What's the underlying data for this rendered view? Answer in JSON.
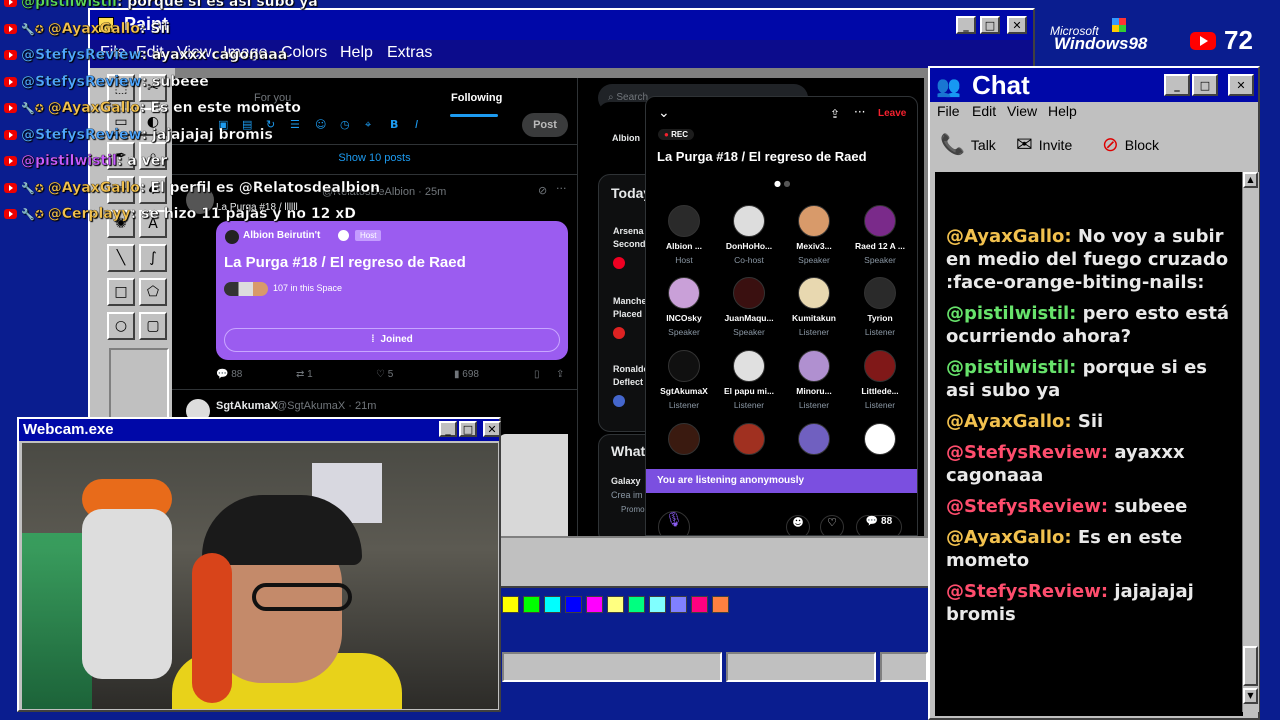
{
  "paint": {
    "title": "Paint",
    "menus": [
      "File",
      "Edit",
      "View",
      "Image",
      "Colors",
      "Help",
      "Extras"
    ],
    "palette": [
      "#ffff00",
      "#00ff00",
      "#00ffff",
      "#0000ff",
      "#ff00ff",
      "#ffff80",
      "#00ff80",
      "#80ffff",
      "#8080ff",
      "#ff0080",
      "#ff8040"
    ]
  },
  "twitter": {
    "tabs": [
      "For you",
      "Following"
    ],
    "post_label": "Post",
    "show_posts": "Show 10 posts",
    "search_placeholder": "Search",
    "post1": {
      "handle": "@RelatosDeAlbion · 25m",
      "body": "La Purga #18 / llllll"
    },
    "card": {
      "host_name": "Albion Beirutin't",
      "host_badge": "Host",
      "title": "La Purga #18 / El regreso de Raed",
      "listeners": "107 in this Space",
      "join_label": "Joined"
    },
    "actions": {
      "replies": "88",
      "retweets": "1",
      "likes": "5",
      "views": "698"
    },
    "post2": {
      "name": "SgtAkumaX",
      "handle": "@SgtAkumaX · 21m"
    },
    "sidebar": {
      "today": "Today",
      "albion": "Albion",
      "trends": [
        {
          "line1": "Arsena",
          "line2": "Second"
        },
        {
          "line1": "Manche",
          "line2": "Placed"
        },
        {
          "line1": "Ronaldo",
          "line2": "Deflect"
        }
      ],
      "whats": "What",
      "galaxy": "Galaxy",
      "galaxy_sub": "Crea im",
      "promo": "Promo"
    }
  },
  "space": {
    "rec": "REC",
    "leave": "Leave",
    "title": "La Purga #18 / El regreso de Raed",
    "people": [
      {
        "name": "Albion ...",
        "role": "Host",
        "color": "#2a2a2a"
      },
      {
        "name": "DonHoHo...",
        "role": "Co-host",
        "color": "#dddddd"
      },
      {
        "name": "Mexiv3...",
        "role": "Speaker",
        "color": "#d89a6a"
      },
      {
        "name": "Raed 12 A ...",
        "role": "Speaker",
        "color": "#7a2a8a"
      },
      {
        "name": "INCOsky",
        "role": "Speaker",
        "color": "#c9a0d8"
      },
      {
        "name": "JuanMaqu...",
        "role": "Speaker",
        "color": "#3a1010"
      },
      {
        "name": "Kumitakun",
        "role": "Listener",
        "color": "#e8d8b0"
      },
      {
        "name": "Tyrion",
        "role": "Listener",
        "color": "#2a2a2a"
      },
      {
        "name": "SgtAkumaX",
        "role": "Listener",
        "color": "#101010"
      },
      {
        "name": "El papu mi...",
        "role": "Listener",
        "color": "#e0e0e0"
      },
      {
        "name": "Minoru...",
        "role": "Listener",
        "color": "#b090d0"
      },
      {
        "name": "Littlede...",
        "role": "Listener",
        "color": "#801818"
      },
      {
        "name": "",
        "role": "",
        "color": "#3a1a10"
      },
      {
        "name": "",
        "role": "",
        "color": "#a03020"
      },
      {
        "name": "",
        "role": "",
        "color": "#7060c0"
      },
      {
        "name": "",
        "role": "",
        "color": "#ffffff"
      }
    ],
    "listening": "You are listening anonymously",
    "comments": "88"
  },
  "branding": {
    "microsoft": "Microsoft",
    "windows": "Windows98",
    "viewers": "72"
  },
  "chat": {
    "title": "Chat",
    "menus": [
      "File",
      "Edit",
      "View",
      "Help"
    ],
    "toolbar": {
      "talk": "Talk",
      "invite": "Invite",
      "block": "Block"
    },
    "messages": [
      {
        "user": "@AyaxGallo:",
        "text": " No voy a subir en medio del fuego cruzado :face-orange-biting-nails:",
        "color": "#f2c14e"
      },
      {
        "user": "@pistilwistil:",
        "text": " pero esto está ocurriendo ahora?",
        "color": "#67e36b"
      },
      {
        "user": "@pistilwistil:",
        "text": " porque si es asi subo ya",
        "color": "#67e36b"
      },
      {
        "user": "@AyaxGallo:",
        "text": " Sii",
        "color": "#f2c14e"
      },
      {
        "user": "@StefysReview:",
        "text": " ayaxxx cagonaaa",
        "color": "#ff4d6d"
      },
      {
        "user": "@StefysReview:",
        "text": " subeee",
        "color": "#ff4d6d"
      },
      {
        "user": "@AyaxGallo:",
        "text": " Es en este mometo",
        "color": "#f2c14e"
      },
      {
        "user": "@StefysReview:",
        "text": " jajajajaj bromis",
        "color": "#ff4d6d"
      }
    ]
  },
  "webcam": {
    "title": "Webcam.exe"
  },
  "overlay": [
    {
      "user": "@pistilwistil",
      "text": ": porque si es asi subo ya",
      "color": "#5bd85b",
      "badge": false
    },
    {
      "user": "@AyaxGallo",
      "text": ": Sii",
      "color": "#f2c14e",
      "badge": true
    },
    {
      "user": "@StefysReview",
      "text": ": ayaxxx cagonaaa",
      "color": "#4ea7ff",
      "badge": false
    },
    {
      "user": "@StefysReview",
      "text": ": subeee",
      "color": "#4ea7ff",
      "badge": false
    },
    {
      "user": "@AyaxGallo",
      "text": ": Es en este mometo",
      "color": "#f2c14e",
      "badge": true
    },
    {
      "user": "@StefysReview",
      "text": ": jajajajaj bromis",
      "color": "#4ea7ff",
      "badge": false
    },
    {
      "user": "@pistilwistil",
      "text": ": a ver",
      "color": "#c95cff",
      "badge": false
    },
    {
      "user": "@AyaxGallo",
      "text": ": El perfil es @Relatosdealbion",
      "color": "#f2c14e",
      "badge": true
    },
    {
      "user": "@Cerplayy",
      "text": ": se hizo 11 pajas y no 12 xD",
      "color": "#f2c14e",
      "badge": true
    }
  ]
}
